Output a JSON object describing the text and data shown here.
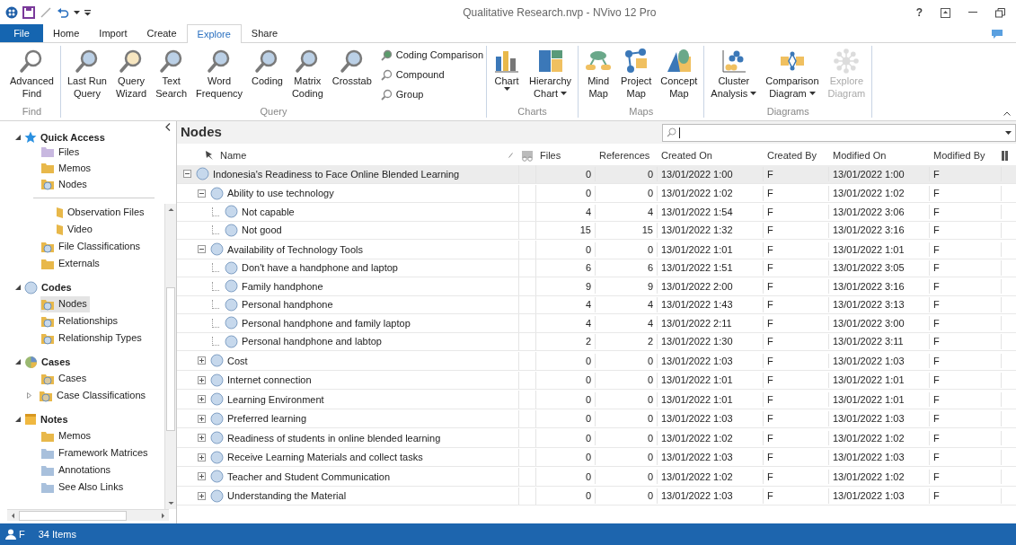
{
  "window": {
    "title": "Qualitative Research.nvp - NVivo 12 Pro",
    "help": "?"
  },
  "tabs": [
    {
      "label": "File",
      "kind": "file",
      "selected": false
    },
    {
      "label": "Home",
      "kind": "tab",
      "selected": false
    },
    {
      "label": "Import",
      "kind": "tab",
      "selected": false
    },
    {
      "label": "Create",
      "kind": "tab",
      "selected": false
    },
    {
      "label": "Explore",
      "kind": "tab",
      "selected": true
    },
    {
      "label": "Share",
      "kind": "tab",
      "selected": false
    }
  ],
  "ribbon": [
    {
      "name": "Find",
      "buttons": [
        {
          "lines": [
            "Advanced",
            "Find"
          ],
          "dropdown": false,
          "disabled": false
        }
      ]
    },
    {
      "name": "Query",
      "buttons": [
        {
          "lines": [
            "Last Run",
            "Query"
          ],
          "dropdown": false,
          "disabled": false
        },
        {
          "lines": [
            "Query",
            "Wizard"
          ],
          "dropdown": false,
          "disabled": false
        },
        {
          "lines": [
            "Text",
            "Search"
          ],
          "dropdown": false,
          "disabled": false
        },
        {
          "lines": [
            "Word",
            "Frequency"
          ],
          "dropdown": false,
          "disabled": false
        },
        {
          "lines": [
            "Coding"
          ],
          "dropdown": false,
          "disabled": false
        },
        {
          "lines": [
            "Matrix",
            "Coding"
          ],
          "dropdown": false,
          "disabled": false
        },
        {
          "lines": [
            "Crosstab"
          ],
          "dropdown": false,
          "disabled": false
        }
      ],
      "small": [
        "Coding Comparison",
        "Compound",
        "Group"
      ]
    },
    {
      "name": "Charts",
      "buttons": [
        {
          "lines": [
            "Chart"
          ],
          "dropdown": true,
          "disabled": false
        },
        {
          "lines": [
            "Hierarchy",
            "Chart"
          ],
          "dropdown": true,
          "disabled": false
        }
      ]
    },
    {
      "name": "Maps",
      "buttons": [
        {
          "lines": [
            "Mind",
            "Map"
          ],
          "dropdown": false,
          "disabled": false
        },
        {
          "lines": [
            "Project",
            "Map"
          ],
          "dropdown": false,
          "disabled": false
        },
        {
          "lines": [
            "Concept",
            "Map"
          ],
          "dropdown": false,
          "disabled": false
        }
      ]
    },
    {
      "name": "Diagrams",
      "buttons": [
        {
          "lines": [
            "Cluster",
            "Analysis"
          ],
          "dropdown": true,
          "disabled": false
        },
        {
          "lines": [
            "Comparison",
            "Diagram"
          ],
          "dropdown": true,
          "disabled": false
        },
        {
          "lines": [
            "Explore",
            "Diagram"
          ],
          "dropdown": false,
          "disabled": true
        }
      ]
    }
  ],
  "sidebar": {
    "quick_access": {
      "title": "Quick Access",
      "expanded": true,
      "items": [
        {
          "label": "Files",
          "selected": false
        },
        {
          "label": "Memos",
          "selected": false
        },
        {
          "label": "Nodes",
          "selected": false
        }
      ]
    },
    "sections": [
      {
        "items": [
          {
            "label": "Observation Files",
            "kind": "sub",
            "selected": false
          },
          {
            "label": "Video",
            "kind": "sub",
            "selected": false
          },
          {
            "label": "File Classifications",
            "kind": "item",
            "selected": false
          },
          {
            "label": "Externals",
            "kind": "item",
            "selected": false
          }
        ]
      },
      {
        "title": "Codes",
        "expanded": true,
        "items": [
          {
            "label": "Nodes",
            "kind": "item",
            "selected": true
          },
          {
            "label": "Relationships",
            "kind": "item",
            "selected": false
          },
          {
            "label": "Relationship Types",
            "kind": "item",
            "selected": false
          }
        ]
      },
      {
        "title": "Cases",
        "expanded": true,
        "items": [
          {
            "label": "Cases",
            "kind": "item",
            "selected": false
          },
          {
            "label": "Case Classifications",
            "kind": "collapsed",
            "selected": false
          }
        ]
      },
      {
        "title": "Notes",
        "expanded": true,
        "items": [
          {
            "label": "Memos",
            "kind": "item",
            "selected": false
          },
          {
            "label": "Framework Matrices",
            "kind": "item",
            "selected": false
          },
          {
            "label": "Annotations",
            "kind": "item",
            "selected": false
          },
          {
            "label": "See Also Links",
            "kind": "item",
            "selected": false
          }
        ]
      }
    ]
  },
  "nodes": {
    "title": "Nodes",
    "columns": [
      "Name",
      "Files",
      "References",
      "Created On",
      "Created By",
      "Modified On",
      "Modified By"
    ],
    "rows": [
      {
        "name": "Indonesia's Readiness to Face Online Blended Learning",
        "files": "0",
        "references": "0",
        "created_on": "13/01/2022 1:00",
        "created_by": "F",
        "modified_on": "13/01/2022 1:00",
        "modified_by": "F",
        "expanded": true,
        "selected": true,
        "children": [
          {
            "name": "Ability to use technology",
            "files": "0",
            "references": "0",
            "created_on": "13/01/2022 1:02",
            "created_by": "F",
            "modified_on": "13/01/2022 1:02",
            "modified_by": "F",
            "expanded": true,
            "selected": false,
            "children": [
              {
                "name": "Not capable",
                "files": "4",
                "references": "4",
                "created_on": "13/01/2022 1:54",
                "created_by": "F",
                "modified_on": "13/01/2022 3:06",
                "modified_by": "F",
                "selected": false
              },
              {
                "name": "Not good",
                "files": "15",
                "references": "15",
                "created_on": "13/01/2022 1:32",
                "created_by": "F",
                "modified_on": "13/01/2022 3:16",
                "modified_by": "F",
                "selected": false
              }
            ]
          },
          {
            "name": "Availability of Technology Tools",
            "files": "0",
            "references": "0",
            "created_on": "13/01/2022 1:01",
            "created_by": "F",
            "modified_on": "13/01/2022 1:01",
            "modified_by": "F",
            "expanded": true,
            "selected": false,
            "children": [
              {
                "name": "Don't have a handphone and laptop",
                "files": "6",
                "references": "6",
                "created_on": "13/01/2022 1:51",
                "created_by": "F",
                "modified_on": "13/01/2022 3:05",
                "modified_by": "F",
                "selected": false
              },
              {
                "name": "Family handphone",
                "files": "9",
                "references": "9",
                "created_on": "13/01/2022 2:00",
                "created_by": "F",
                "modified_on": "13/01/2022 3:16",
                "modified_by": "F",
                "selected": false
              },
              {
                "name": "Personal handphone",
                "files": "4",
                "references": "4",
                "created_on": "13/01/2022 1:43",
                "created_by": "F",
                "modified_on": "13/01/2022 3:13",
                "modified_by": "F",
                "selected": false
              },
              {
                "name": "Personal handphone and family laptop",
                "files": "4",
                "references": "4",
                "created_on": "13/01/2022 2:11",
                "created_by": "F",
                "modified_on": "13/01/2022 3:00",
                "modified_by": "F",
                "selected": false
              },
              {
                "name": "Personal handphone and labtop",
                "files": "2",
                "references": "2",
                "created_on": "13/01/2022 1:30",
                "created_by": "F",
                "modified_on": "13/01/2022 3:11",
                "modified_by": "F",
                "selected": false
              }
            ]
          },
          {
            "name": "Cost",
            "files": "0",
            "references": "0",
            "created_on": "13/01/2022 1:03",
            "created_by": "F",
            "modified_on": "13/01/2022 1:03",
            "modified_by": "F",
            "expanded": false,
            "selected": false
          },
          {
            "name": "Internet connection",
            "files": "0",
            "references": "0",
            "created_on": "13/01/2022 1:01",
            "created_by": "F",
            "modified_on": "13/01/2022 1:01",
            "modified_by": "F",
            "expanded": false,
            "selected": false
          },
          {
            "name": "Learning Environment",
            "files": "0",
            "references": "0",
            "created_on": "13/01/2022 1:01",
            "created_by": "F",
            "modified_on": "13/01/2022 1:01",
            "modified_by": "F",
            "expanded": false,
            "selected": false
          },
          {
            "name": "Preferred learning",
            "files": "0",
            "references": "0",
            "created_on": "13/01/2022 1:03",
            "created_by": "F",
            "modified_on": "13/01/2022 1:03",
            "modified_by": "F",
            "expanded": false,
            "selected": false
          },
          {
            "name": "Readiness of students in online blended learning",
            "files": "0",
            "references": "0",
            "created_on": "13/01/2022 1:02",
            "created_by": "F",
            "modified_on": "13/01/2022 1:02",
            "modified_by": "F",
            "expanded": false,
            "selected": false
          },
          {
            "name": "Receive Learning Materials and collect tasks",
            "files": "0",
            "references": "0",
            "created_on": "13/01/2022 1:03",
            "created_by": "F",
            "modified_on": "13/01/2022 1:03",
            "modified_by": "F",
            "expanded": false,
            "selected": false
          },
          {
            "name": "Teacher and Student Communication",
            "files": "0",
            "references": "0",
            "created_on": "13/01/2022 1:02",
            "created_by": "F",
            "modified_on": "13/01/2022 1:02",
            "modified_by": "F",
            "expanded": false,
            "selected": false
          },
          {
            "name": "Understanding the Material",
            "files": "0",
            "references": "0",
            "created_on": "13/01/2022 1:03",
            "created_by": "F",
            "modified_on": "13/01/2022 1:03",
            "modified_by": "F",
            "expanded": false,
            "selected": false
          }
        ]
      }
    ]
  },
  "status_bar": {
    "user": "F",
    "count": "34 Items"
  }
}
